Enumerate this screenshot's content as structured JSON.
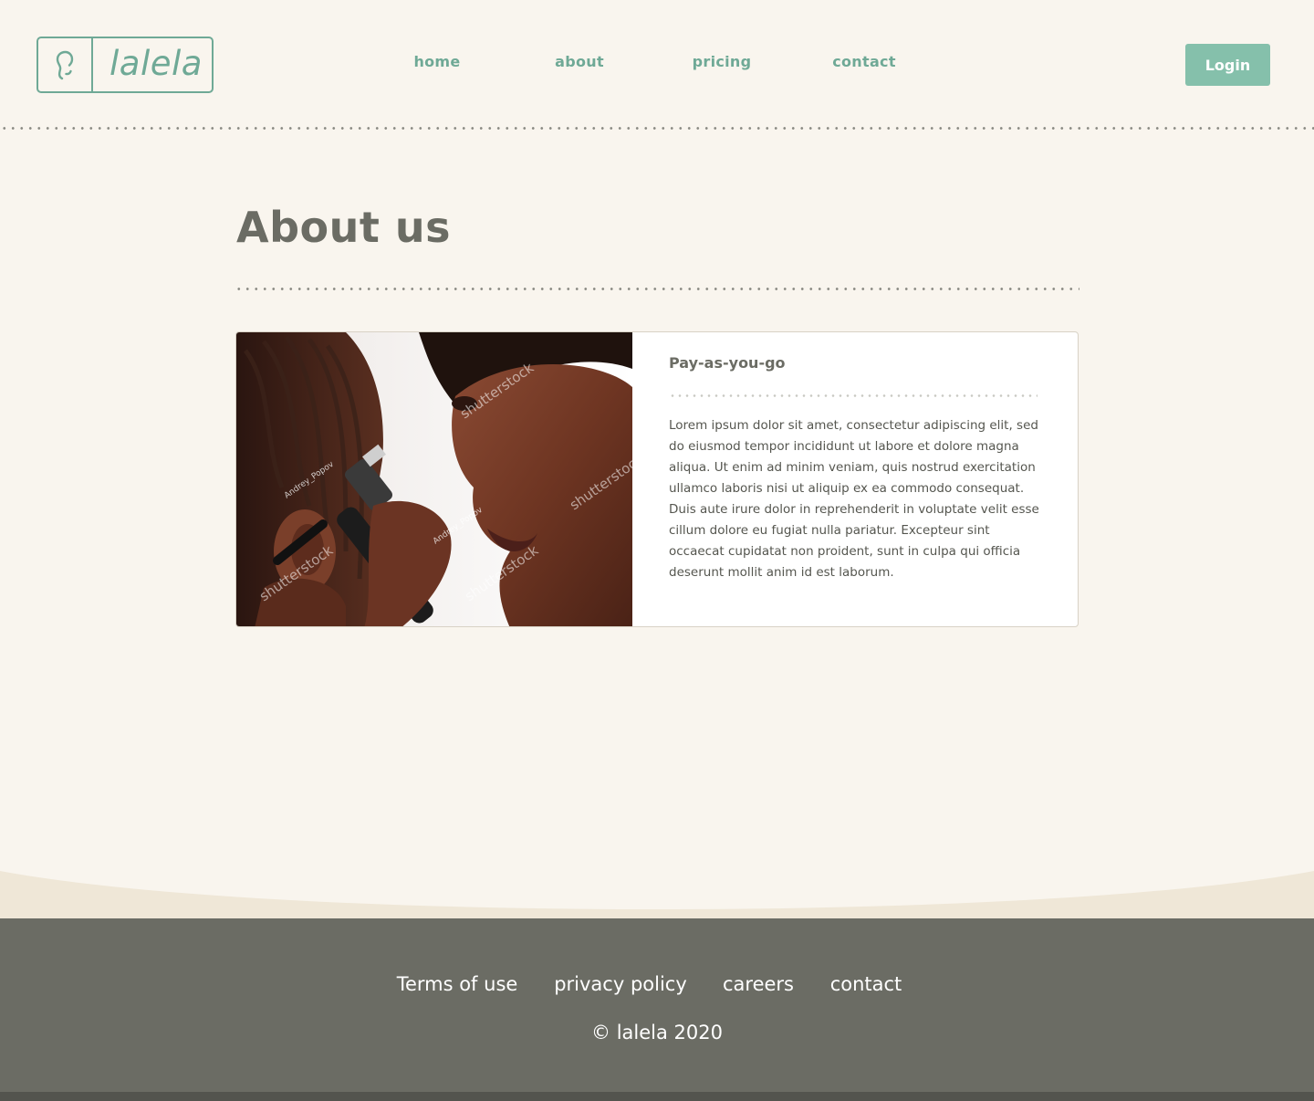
{
  "header": {
    "logo_text": "lalela",
    "nav": [
      "home",
      "about",
      "pricing",
      "contact"
    ],
    "login_label": "Login"
  },
  "main": {
    "title": "About us",
    "card": {
      "title": "Pay-as-you-go",
      "body": "Lorem ipsum dolor sit amet, consectetur adipiscing elit, sed do eiusmod tempor incididunt ut labore et dolore magna aliqua. Ut enim ad minim veniam, quis nostrud exercitation ullamco laboris nisi ut aliquip ex ea commodo consequat. Duis aute irure dolor in reprehenderit in voluptate velit esse cillum dolore eu fugiat nulla pariatur. Excepteur sint occaecat cupidatat non proident, sunt in culpa qui officia deserunt mollit anim id est laborum.",
      "image_watermarks": [
        "shutterstock",
        "Andrey_Popov"
      ]
    }
  },
  "footer": {
    "links": [
      "Terms of use",
      "privacy policy",
      "careers",
      "contact"
    ],
    "copyright": "© lalela 2020"
  },
  "colors": {
    "accent": "#6fa996",
    "button": "#85c0ab",
    "background": "#f9f5ee",
    "footer": "#6b6c64",
    "text": "#6b6c64"
  }
}
